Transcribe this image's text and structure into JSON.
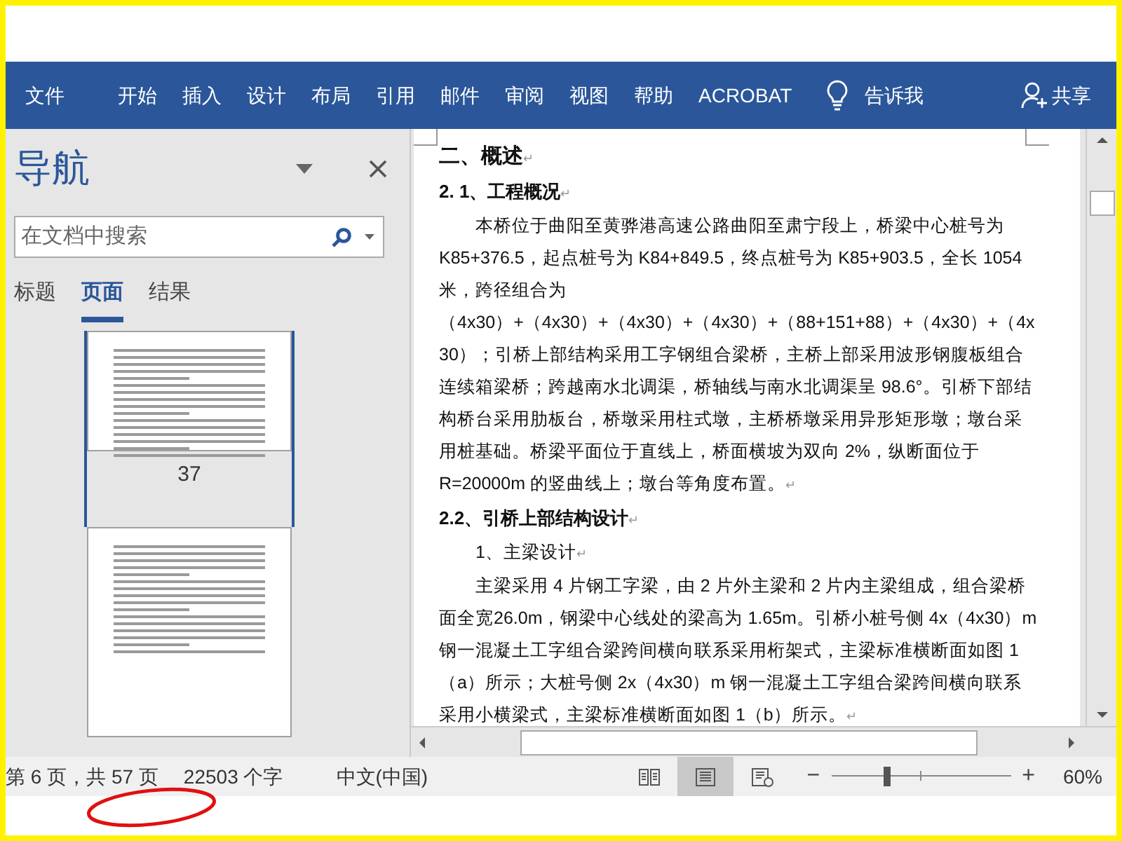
{
  "ribbon": {
    "tabs": [
      "文件",
      "开始",
      "插入",
      "设计",
      "布局",
      "引用",
      "邮件",
      "审阅",
      "视图",
      "帮助",
      "ACROBAT"
    ],
    "tell_me": "告诉我",
    "share": "共享"
  },
  "navigation": {
    "title": "导航",
    "search": {
      "placeholder": "在文档中搜索"
    },
    "tabs": [
      {
        "label": "标题",
        "selected": false
      },
      {
        "label": "页面",
        "selected": true
      },
      {
        "label": "结果",
        "selected": false
      }
    ],
    "pages": [
      {
        "label": "37",
        "selected": true
      },
      {
        "selected": false
      }
    ]
  },
  "document": {
    "paragraphs": [
      {
        "kind": "heading1",
        "text": "二、概述",
        "end_mark": "↵"
      },
      {
        "kind": "heading2",
        "text": "2. 1、工程概况",
        "end_mark": "↵"
      },
      {
        "kind": "body",
        "text": "本桥位于曲阳至黄骅港高速公路曲阳至肃宁段上，桥梁中心桩号为K85+376.5，起点桩号为 K84+849.5，终点桩号为 K85+903.5，全长 1054 米，跨径组合为（4x30）+（4x30）+（4x30）+（4x30）+（88+151+88）+（4x30）+（4x30）；引桥上部结构采用工字钢组合梁桥，主桥上部采用波形钢腹板组合连续箱梁桥；跨越南水北调渠，桥轴线与南水北调渠呈 98.6°。引桥下部结构桥台采用肋板台，桥墩采用柱式墩，主桥桥墩采用异形矩形墩；墩台采用桩基础。桥梁平面位于直线上，桥面横坡为双向 2%，纵断面位于 R=20000m 的竖曲线上；墩台等角度布置。",
        "end_mark": "↵"
      },
      {
        "kind": "heading2",
        "text": "2.2、引桥上部结构设计",
        "end_mark": "↵"
      },
      {
        "kind": "body",
        "text": "1、主梁设计",
        "end_mark": "↵"
      },
      {
        "kind": "body",
        "text": "主梁采用 4 片钢工字梁，由 2 片外主梁和 2 片内主梁组成，组合梁桥面全宽26.0m，钢梁中心线处的梁高为 1.65m。引桥小桩号侧 4x（4x30）m 钢一混凝土工字组合梁跨间横向联系采用桁架式，主梁标准横断面如图 1（a）所示；大桩号侧 2x（4x30）m 钢一混凝土工字组合梁跨间横向联系采用小横梁式，主梁标准横断面如图 1（b）所示。",
        "end_mark": "↵"
      }
    ]
  },
  "status_bar": {
    "page": "第 6 页，共 57 页",
    "words": "22503 个字",
    "language": "中文(中国)",
    "views": [
      {
        "kind": "read",
        "selected": false
      },
      {
        "kind": "print",
        "selected": true
      },
      {
        "kind": "web",
        "selected": false
      }
    ],
    "zoom": {
      "out": "−",
      "in": "+",
      "level": 0.3,
      "reading": "60%"
    }
  }
}
